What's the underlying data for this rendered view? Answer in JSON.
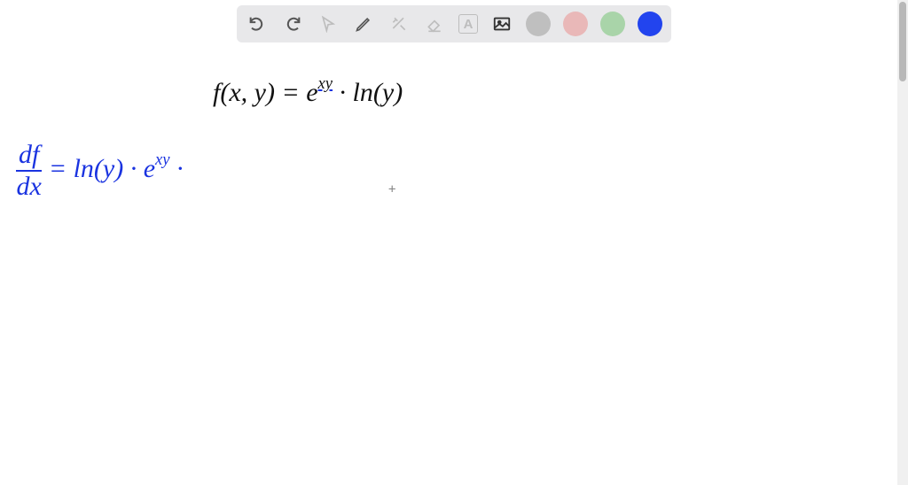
{
  "toolbar": {
    "undo": "undo",
    "redo": "redo",
    "pointer": "pointer",
    "pen": "pen",
    "tools": "tools",
    "eraser": "eraser",
    "textbox": "A",
    "image": "image",
    "colors": {
      "gray": "#bfbfbf",
      "pink": "#e9b8b8",
      "green": "#a9d4a9",
      "blue": "#2244ee"
    }
  },
  "math": {
    "line1_lhs": "f(x, y) = ",
    "line1_rhs_e": "e",
    "line1_rhs_exp": "xy",
    "line1_rhs_ln": " · ln(y)",
    "line2_frac_num": "df",
    "line2_frac_den": "dx",
    "line2_eq": " = ln(y) · e",
    "line2_exp": "xy",
    "line2_dot": " ·"
  },
  "cursor": "+"
}
